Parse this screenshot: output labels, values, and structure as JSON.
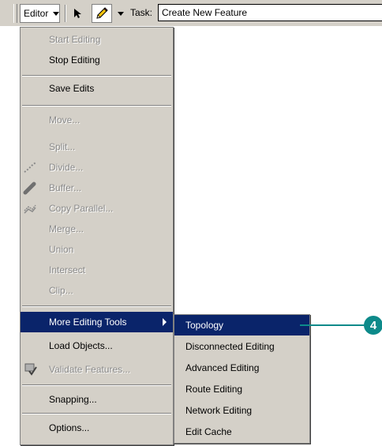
{
  "toolbar": {
    "editor_label": "Editor",
    "task_label": "Task:",
    "task_value": "Create New Feature"
  },
  "menu": {
    "items": [
      {
        "label": "Start Editing",
        "enabled": false
      },
      {
        "label": "Stop Editing",
        "enabled": true
      },
      {
        "label": "Save Edits",
        "enabled": true
      },
      {
        "label": "Move...",
        "enabled": false
      },
      {
        "label": "Split...",
        "enabled": false
      },
      {
        "label": "Divide...",
        "enabled": false,
        "icon": "divide-icon"
      },
      {
        "label": "Buffer...",
        "enabled": false,
        "icon": "buffer-icon"
      },
      {
        "label": "Copy Parallel...",
        "enabled": false,
        "icon": "copy-parallel-icon"
      },
      {
        "label": "Merge...",
        "enabled": false
      },
      {
        "label": "Union",
        "enabled": false
      },
      {
        "label": "Intersect",
        "enabled": false
      },
      {
        "label": "Clip...",
        "enabled": false
      },
      {
        "label": "More Editing Tools",
        "enabled": true,
        "highlighted": true,
        "submenu": true
      },
      {
        "label": "Load Objects...",
        "enabled": true
      },
      {
        "label": "Validate Features...",
        "enabled": false,
        "icon": "validate-icon"
      },
      {
        "label": "Snapping...",
        "enabled": true
      },
      {
        "label": "Options...",
        "enabled": true
      }
    ]
  },
  "submenu": {
    "items": [
      {
        "label": "Topology",
        "highlighted": true
      },
      {
        "label": "Disconnected Editing"
      },
      {
        "label": "Advanced Editing"
      },
      {
        "label": "Route Editing"
      },
      {
        "label": "Network Editing"
      },
      {
        "label": "Edit Cache"
      }
    ]
  },
  "callout": {
    "number": "4"
  },
  "colors": {
    "highlight": "#0a246a",
    "menu_bg": "#d4d0c8",
    "callout": "#0d8a8a"
  }
}
